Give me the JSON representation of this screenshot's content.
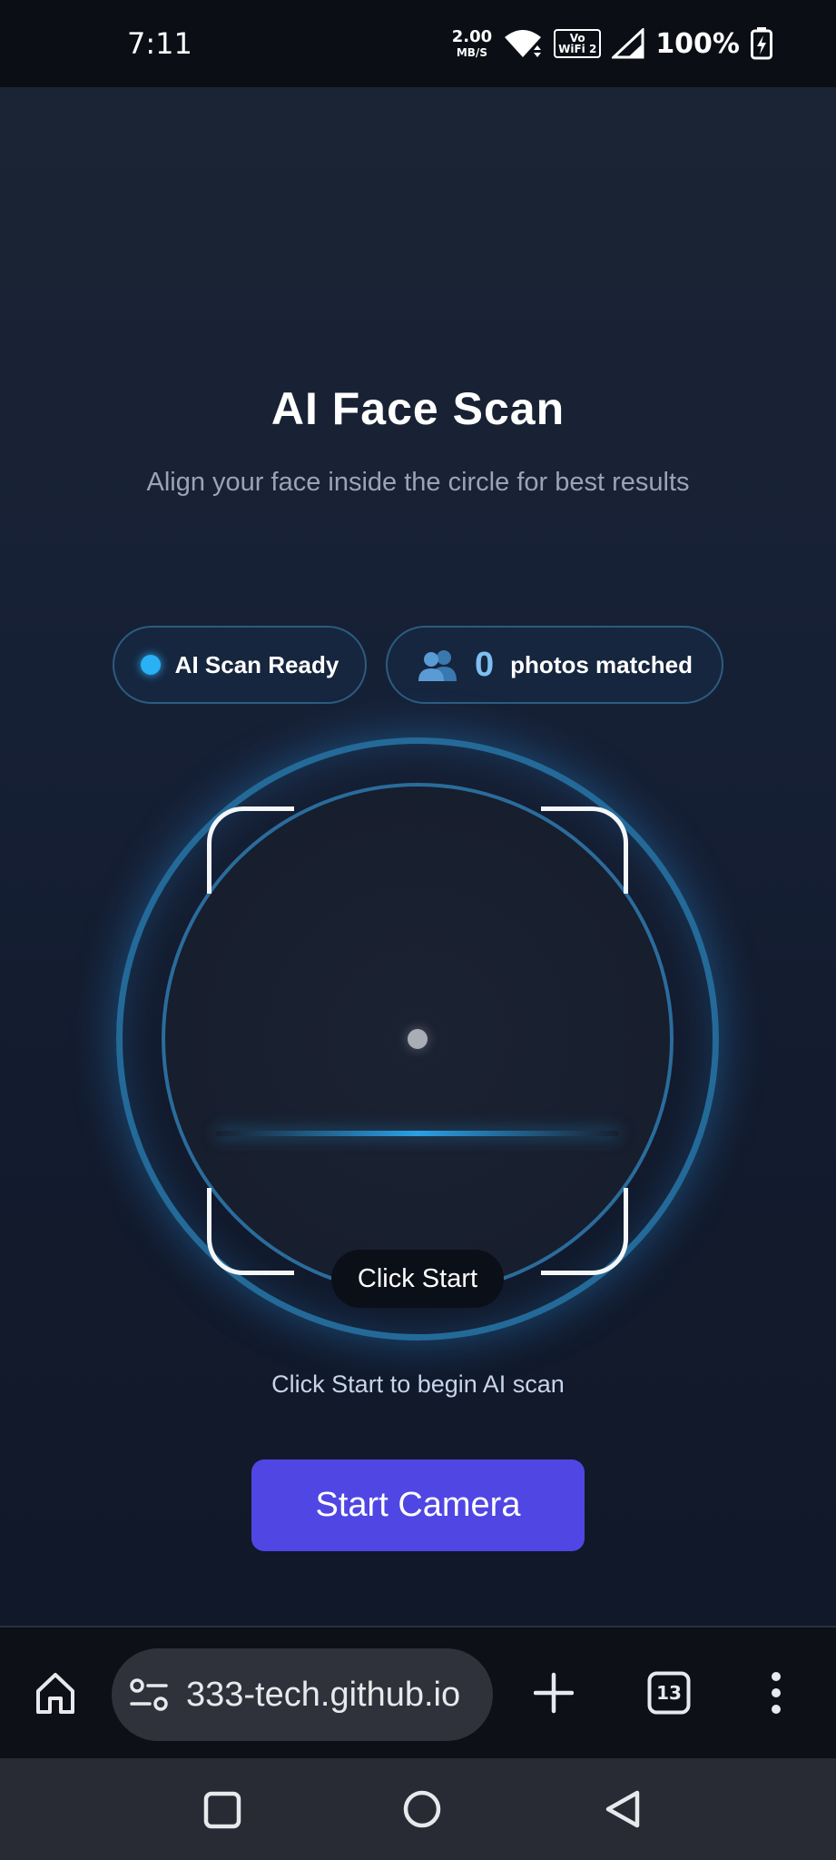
{
  "status_bar": {
    "time": "7:11",
    "net_speed_value": "2.00",
    "net_speed_unit": "MB/S",
    "vowifi_top": "Vo",
    "vowifi_bottom": "WiFi 2",
    "battery": "100%"
  },
  "header": {
    "title": "AI Face Scan",
    "subtitle": "Align your face inside the circle for best results"
  },
  "badges": {
    "ready_label": "AI Scan Ready",
    "matched_count": "0",
    "matched_label": "photos matched"
  },
  "scanner": {
    "badge_label": "Click Start"
  },
  "hint": "Click Start to begin AI scan",
  "start_button_label": "Start Camera",
  "browser": {
    "url": "333-tech.github.io",
    "tab_count": "13"
  },
  "colors": {
    "accent": "#5046e4",
    "ring": "#246a99",
    "status_dot": "#2ab0f5"
  }
}
